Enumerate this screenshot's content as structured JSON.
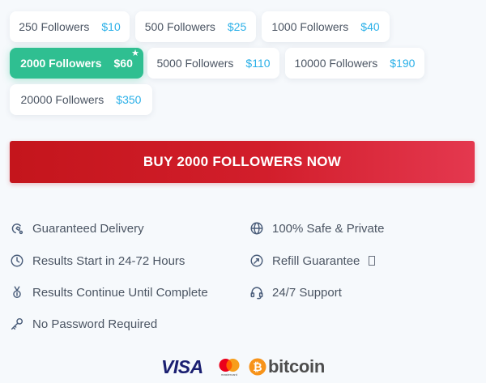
{
  "packages": [
    {
      "quantity": "250 Followers",
      "price": "$10",
      "selected": false
    },
    {
      "quantity": "500 Followers",
      "price": "$25",
      "selected": false
    },
    {
      "quantity": "1000 Followers",
      "price": "$40",
      "selected": false
    },
    {
      "quantity": "2000 Followers",
      "price": "$60",
      "selected": true,
      "badge": "★"
    },
    {
      "quantity": "5000 Followers",
      "price": "$110",
      "selected": false
    },
    {
      "quantity": "10000 Followers",
      "price": "$190",
      "selected": false
    },
    {
      "quantity": "20000 Followers",
      "price": "$350",
      "selected": false
    }
  ],
  "buy_button": {
    "label": "BUY 2000 FOLLOWERS NOW"
  },
  "features": [
    {
      "icon": "delivery-icon",
      "label": "Guaranteed Delivery"
    },
    {
      "icon": "globe-icon",
      "label": "100% Safe & Private"
    },
    {
      "icon": "clock-icon",
      "label": "Results Start in 24-72 Hours"
    },
    {
      "icon": "refill-icon",
      "label": "Refill Guarantee",
      "suffix": "▯"
    },
    {
      "icon": "medal-icon",
      "label": "Results Continue Until Complete"
    },
    {
      "icon": "headset-icon",
      "label": "24/7 Support"
    },
    {
      "icon": "key-icon",
      "label": "No Password Required"
    }
  ],
  "payments": {
    "visa": "VISA",
    "mastercard": "mastercard",
    "bitcoin": "bitcoin"
  },
  "colors": {
    "selected": "#2fbf91",
    "price": "#2bb0e8",
    "buy_button": "#d21e2b",
    "background": "#f6f9fc"
  }
}
